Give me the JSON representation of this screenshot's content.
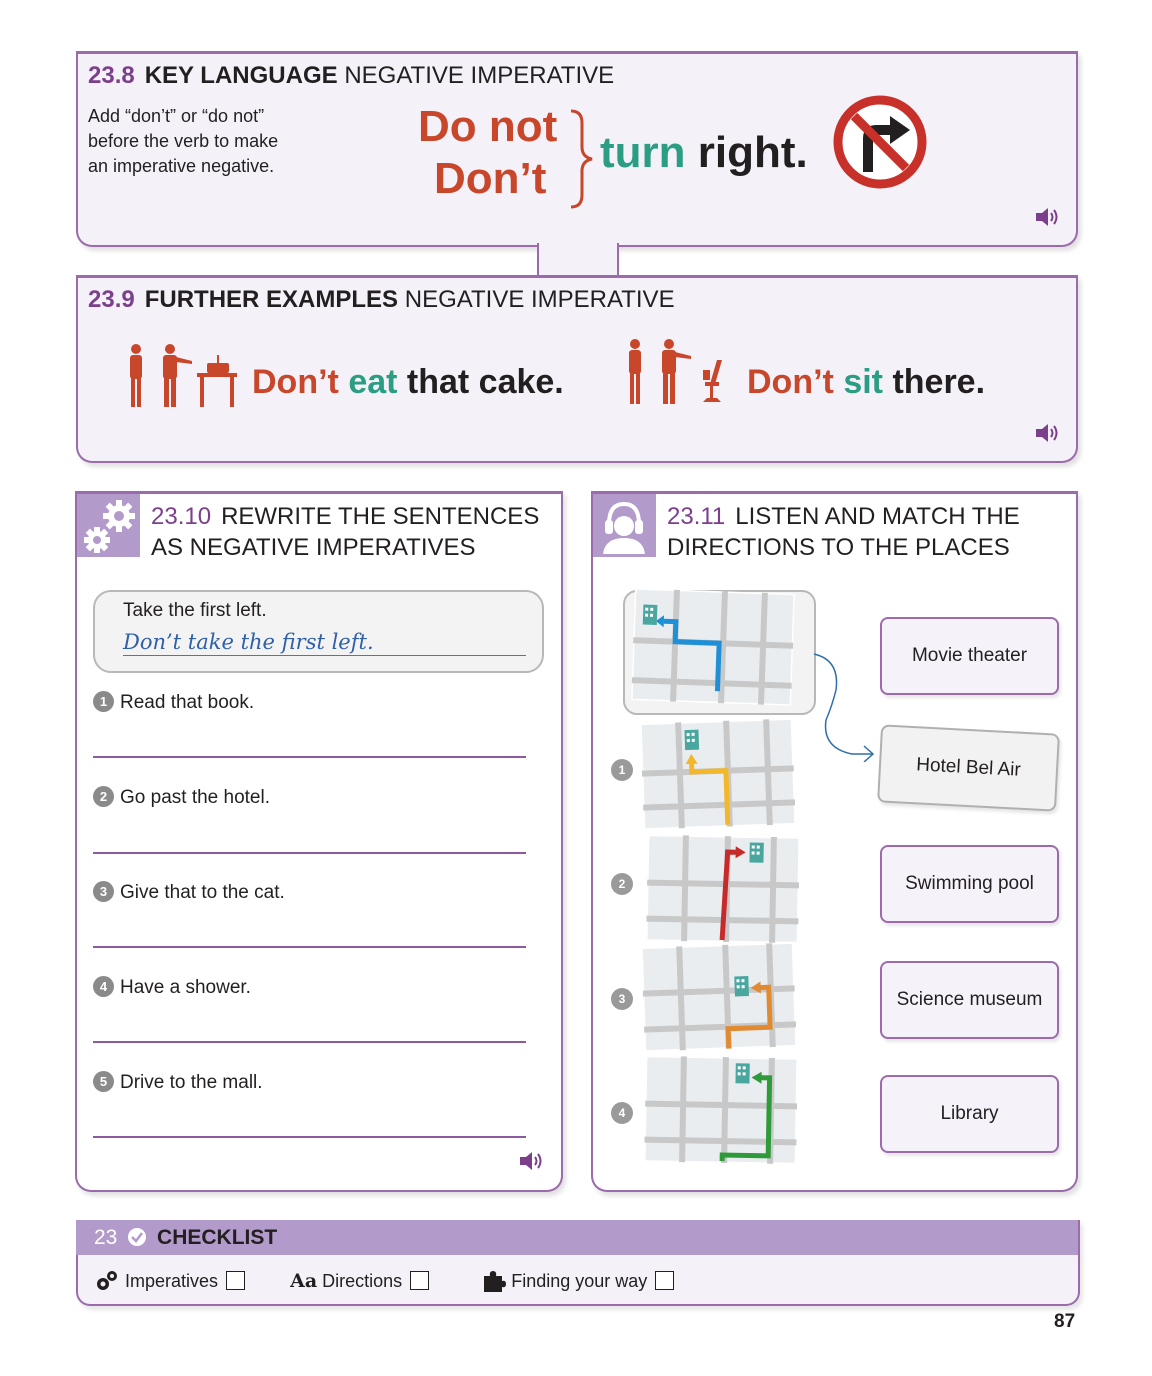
{
  "key_language": {
    "number": "23.8",
    "title_bold": "KEY LANGUAGE",
    "title_rest": "NEGATIVE IMPERATIVE",
    "instruction": [
      "Add “don’t” or “do not”",
      "before the verb to make",
      "an imperative negative."
    ],
    "neg_full": "Do not",
    "neg_short": "Don’t",
    "verb": "turn",
    "rest": "right."
  },
  "further_examples": {
    "number": "23.9",
    "title_bold": "FURTHER EXAMPLES",
    "title_rest": "NEGATIVE IMPERATIVE",
    "examples": [
      {
        "neg": "Don’t",
        "verb": "eat",
        "rest": "that cake."
      },
      {
        "neg": "Don’t",
        "verb": "sit",
        "rest": "there."
      }
    ]
  },
  "rewrite": {
    "number": "23.10",
    "title_line1": "REWRITE THE SENTENCES",
    "title_line2": "AS NEGATIVE IMPERATIVES",
    "example_prompt": "Take the first left.",
    "example_answer": "Don’t take the first left.",
    "questions": [
      {
        "n": "1",
        "text": "Read that book."
      },
      {
        "n": "2",
        "text": "Go past the hotel."
      },
      {
        "n": "3",
        "text": "Give that to the cat."
      },
      {
        "n": "4",
        "text": "Have a shower."
      },
      {
        "n": "5",
        "text": "Drive to the mall."
      }
    ]
  },
  "listen": {
    "number": "23.11",
    "title_line1": "LISTEN AND MATCH THE",
    "title_line2": "DIRECTIONS TO THE PLACES",
    "map_numbers": [
      "1",
      "2",
      "3",
      "4"
    ],
    "places": [
      "Movie theater",
      "Hotel Bel Air",
      "Swimming pool",
      "Science museum",
      "Library"
    ]
  },
  "checklist": {
    "number": "23",
    "title": "CHECKLIST",
    "items": [
      {
        "icon": "gears-icon",
        "label": "Imperatives"
      },
      {
        "icon": "aa-icon",
        "glyph": "Aa",
        "label": "Directions"
      },
      {
        "icon": "puzzle-icon",
        "label": "Finding your way"
      }
    ]
  },
  "page_number": "87",
  "colors": {
    "accent": "#9b6bab",
    "number": "#7b3f8c",
    "red": "#c8462a",
    "green": "#2a9d82"
  }
}
